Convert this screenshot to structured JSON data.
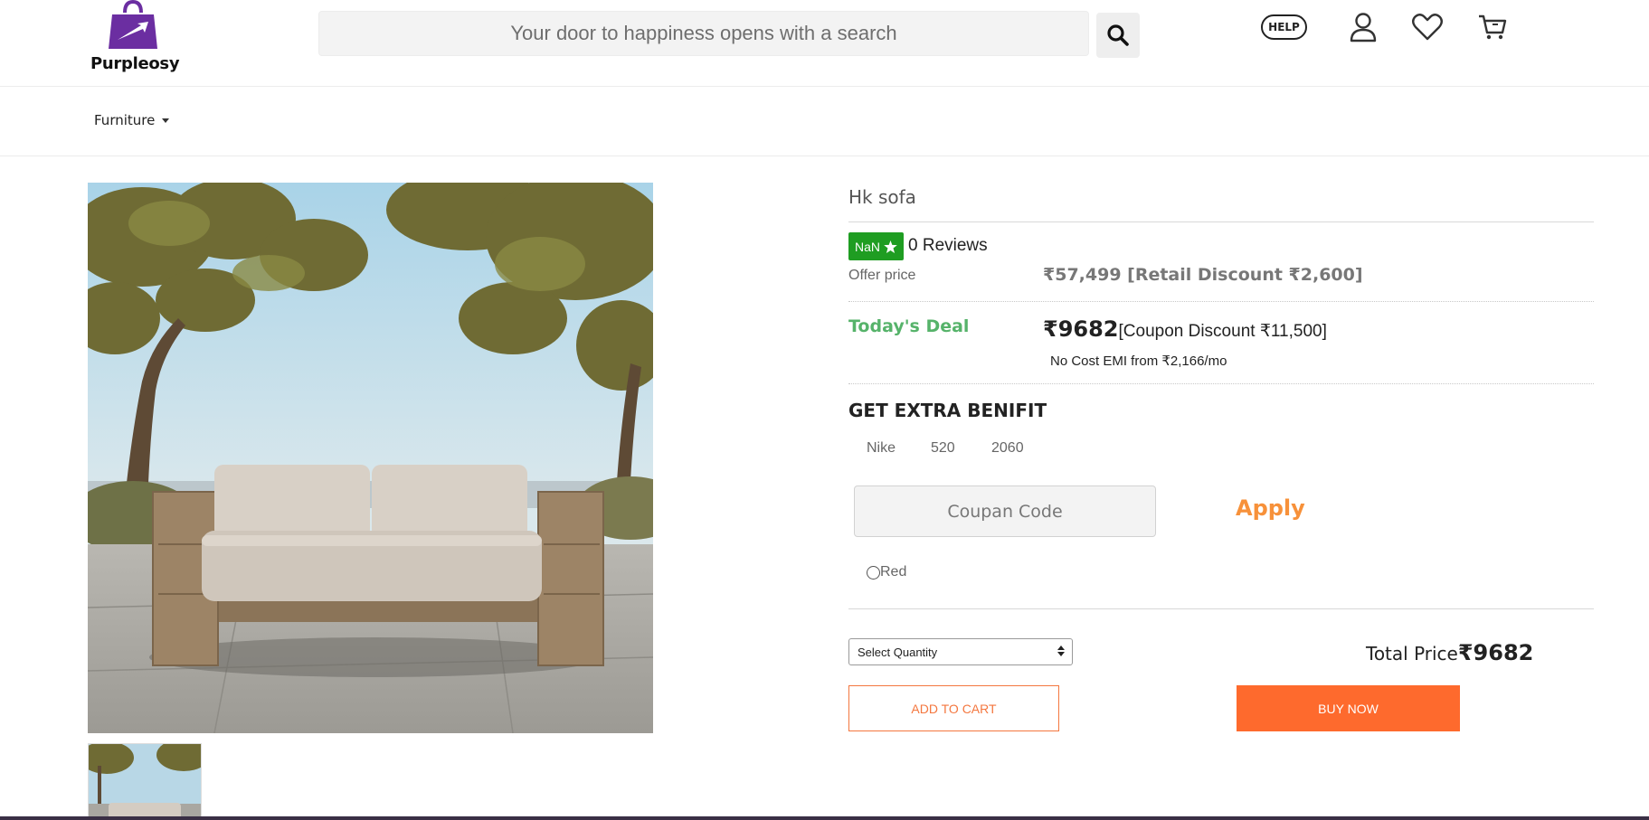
{
  "brand": {
    "name": "Purpleosy",
    "logo_color": "#6b2ea1"
  },
  "search": {
    "placeholder": "Your door to happiness opens with a search",
    "icon": "search-icon"
  },
  "header_icons": {
    "help_label": "HELP",
    "account": "user-icon",
    "wishlist": "heart-icon",
    "cart": "cart-icon"
  },
  "nav": {
    "category_label": "Furniture"
  },
  "product": {
    "title": "Hk sofa",
    "rating_badge": "NaN",
    "reviews": "0 Reviews",
    "offer_label": "Offer price",
    "offer_value": "₹57,499 [Retail Discount ₹2,600]",
    "deal_label": "Today's Deal",
    "deal_currency": "₹ ",
    "deal_price": "9682",
    "deal_coupon": "[Coupon Discount ₹11,500]",
    "emi": "No Cost EMI from ₹2,166/mo"
  },
  "extra_benefit": {
    "title": "GET EXTRA BENIFIT",
    "tags": [
      "Nike",
      "520",
      "2060"
    ],
    "coupon_placeholder": "Coupan Code",
    "apply_label": "Apply",
    "radio_label": "Red"
  },
  "purchase": {
    "quantity_placeholder": "Select Quantity",
    "total_label": "Total Price ",
    "total_value": "₹9682",
    "add_to_cart_label": "ADD TO CART",
    "buy_now_label": "BUY NOW"
  },
  "colors": {
    "accent": "#fe6a2d",
    "deal_green": "#56b36a",
    "rating_green": "#1f9d22",
    "apply_orange": "#f7913a"
  }
}
